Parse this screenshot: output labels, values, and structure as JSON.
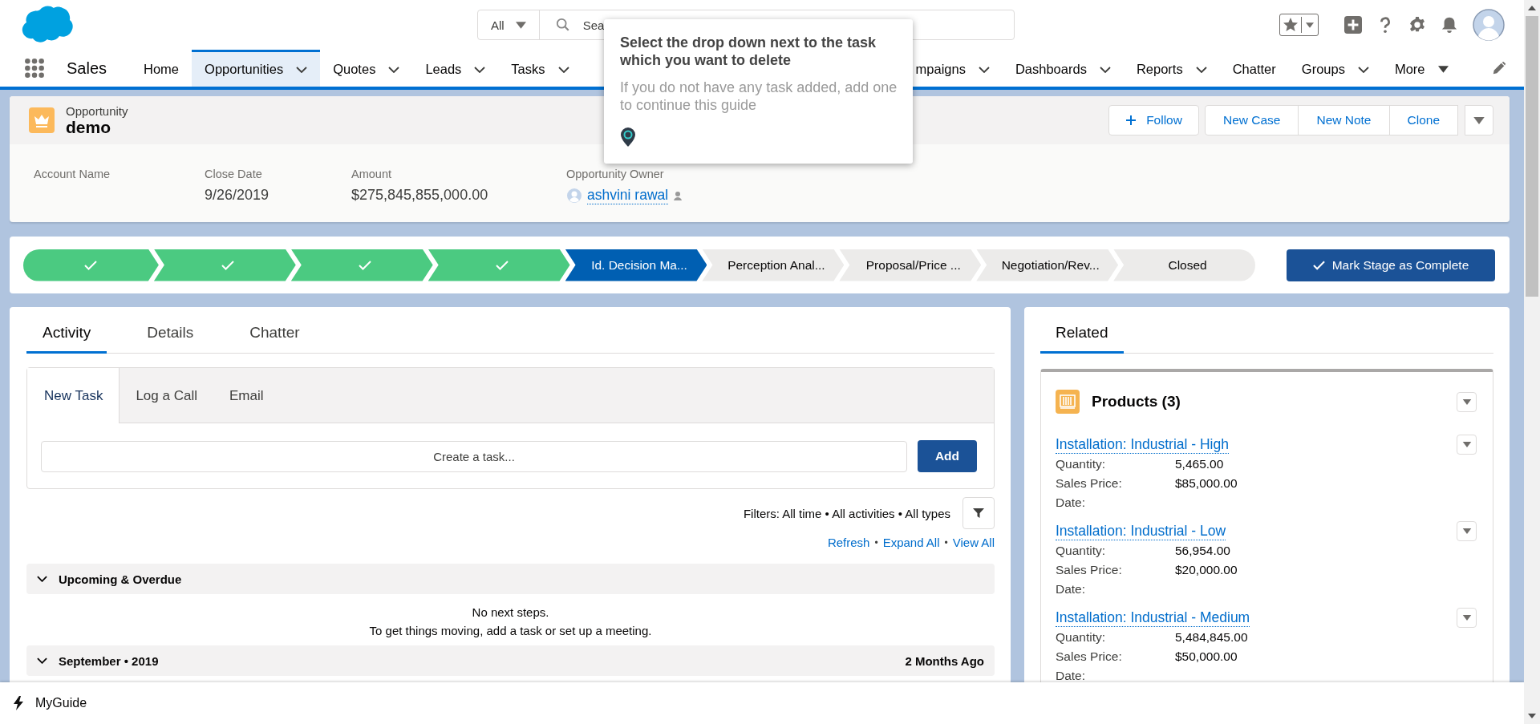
{
  "header": {
    "search": {
      "scope": "All",
      "placeholder": "Sea"
    }
  },
  "nav": {
    "app_name": "Sales",
    "items": [
      {
        "label": "Home",
        "kind": "link",
        "selected": false
      },
      {
        "label": "Opportunities",
        "kind": "menu",
        "selected": true
      },
      {
        "label": "Quotes",
        "kind": "menu",
        "selected": false
      },
      {
        "label": "Leads",
        "kind": "menu",
        "selected": false
      },
      {
        "label": "Tasks",
        "kind": "menu",
        "selected": false
      },
      {
        "label": "mpaigns",
        "kind": "menu",
        "selected": false,
        "partly_hidden": true
      },
      {
        "label": "Dashboards",
        "kind": "menu",
        "selected": false
      },
      {
        "label": "Reports",
        "kind": "menu",
        "selected": false
      },
      {
        "label": "Chatter",
        "kind": "link",
        "selected": false
      },
      {
        "label": "Groups",
        "kind": "menu",
        "selected": false
      },
      {
        "label": "More",
        "kind": "overflow",
        "selected": false
      }
    ]
  },
  "record": {
    "object_type": "Opportunity",
    "name": "demo",
    "follow": "Follow",
    "actions": [
      "New Case",
      "New Note",
      "Clone"
    ],
    "fields": [
      {
        "label": "Account Name",
        "kind": "text"
      },
      {
        "label": "Close Date",
        "kind": "text",
        "value": "9/26/2019"
      },
      {
        "label": "Amount",
        "kind": "text",
        "value": "$275,845,855,000.00"
      },
      {
        "label": "Opportunity Owner",
        "kind": "user",
        "value": "ashvini rawal"
      }
    ]
  },
  "path": {
    "stages": [
      {
        "completed": true,
        "selected": false
      },
      {
        "completed": true,
        "selected": false
      },
      {
        "completed": true,
        "selected": false
      },
      {
        "completed": true,
        "selected": false
      },
      {
        "completed": false,
        "selected": true,
        "label": "Id. Decision Ma..."
      },
      {
        "completed": false,
        "selected": false,
        "label": "Perception Anal..."
      },
      {
        "completed": false,
        "selected": false,
        "label": "Proposal/Price ..."
      },
      {
        "completed": false,
        "selected": false,
        "label": "Negotiation/Rev..."
      },
      {
        "completed": false,
        "selected": false,
        "label": "Closed"
      }
    ],
    "complete_button": "Mark Stage as Complete"
  },
  "activity": {
    "tabs": [
      {
        "label": "Activity",
        "selected": true
      },
      {
        "label": "Details",
        "selected": false
      },
      {
        "label": "Chatter",
        "selected": false
      }
    ],
    "composer_tabs": [
      {
        "label": "New Task",
        "selected": true
      },
      {
        "label": "Log a Call",
        "selected": false
      },
      {
        "label": "Email",
        "selected": false
      }
    ],
    "task_placeholder": "Create a task...",
    "add_button": "Add",
    "filters": "Filters: All time • All activities • All types",
    "links": [
      "Refresh",
      "Expand All",
      "View All"
    ],
    "link_separator": "•",
    "sections": [
      {
        "title": "Upcoming & Overdue",
        "expanded": true,
        "empty_lines": [
          "No next steps.",
          "To get things moving, add a task or set up a meeting."
        ]
      },
      {
        "title": "September • 2019",
        "expanded": true,
        "meta": "2 Months Ago"
      }
    ]
  },
  "related": {
    "tabs": [
      {
        "label": "Related",
        "selected": true
      }
    ],
    "products": {
      "title": "Products (3)",
      "items": [
        {
          "name": "Installation: Industrial - High",
          "fields": [
            {
              "label": "Quantity:",
              "value": "5,465.00"
            },
            {
              "label": "Sales Price:",
              "value": "$85,000.00"
            },
            {
              "label": "Date:"
            }
          ]
        },
        {
          "name": "Installation: Industrial - Low",
          "fields": [
            {
              "label": "Quantity:",
              "value": "56,954.00"
            },
            {
              "label": "Sales Price:",
              "value": "$20,000.00"
            },
            {
              "label": "Date:"
            }
          ]
        },
        {
          "name": "Installation: Industrial - Medium",
          "fields": [
            {
              "label": "Quantity:",
              "value": "5,484,845.00"
            },
            {
              "label": "Sales Price:",
              "value": "$50,000.00"
            },
            {
              "label": "Date:"
            }
          ]
        }
      ]
    }
  },
  "guide_tooltip": {
    "title": "Select the drop down next to the task which you want to delete",
    "body": "If you do not have any task added, add one to continue this guide"
  },
  "guide_bar": {
    "label": "MyGuide"
  }
}
